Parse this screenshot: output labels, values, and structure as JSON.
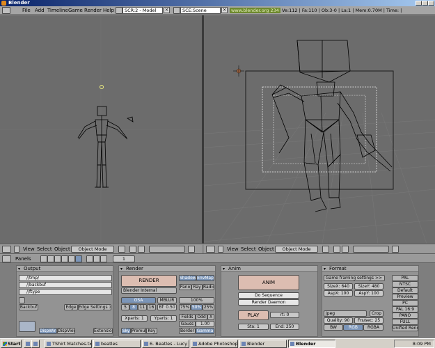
{
  "window": {
    "title": "Blender"
  },
  "info_header": {
    "menus": [
      "File",
      "Add",
      "Timeline",
      "Game",
      "Render",
      "Help"
    ],
    "screen_field": "SCR:2 - Model",
    "scene_field": "SCE:Scene",
    "version": "www.blender.org 234",
    "stats": "Ve:112 | Fa:110 | Ob:3-0 | La:1 | Mem:0.70M | Time: |"
  },
  "left_view_header": {
    "menus": [
      "View",
      "Select",
      "Object"
    ],
    "mode": "Object Mode"
  },
  "right_view_header": {
    "menus": [
      "View",
      "Select",
      "Object"
    ],
    "mode": "Object Mode"
  },
  "buttons_header": {
    "panels_label": "Panels",
    "frame": "1"
  },
  "output_panel": {
    "title": "Output",
    "paths": [
      "//tmp/",
      "//backbuf",
      "//ftype"
    ],
    "backbuf": "Backbuf",
    "edge": "Edge",
    "edge_settings": "Edge Settings >>",
    "dispwin": "DispWin",
    "dispview": "DispView",
    "extensions": "Extensions"
  },
  "render_panel": {
    "title": "Render",
    "render_button": "RENDER",
    "renderer": "Blender Internal",
    "shadow": "Shadow",
    "envmap": "EnvMap",
    "pano": "Pano",
    "ray": "Ray",
    "radio": "Radio",
    "osa": "OSA",
    "mblur": "MBLUR",
    "osa_levels": [
      "5",
      "8",
      "11",
      "16"
    ],
    "bf": "Bf: 0.50",
    "percent_100": "100%",
    "percents": [
      "75%",
      "50%",
      "25%"
    ],
    "xparts": "Xparts: 1",
    "yparts": "Yparts: 1",
    "fields": "Fields",
    "odd": "Odd",
    "x": "X",
    "gauss": "Gauss",
    "gauss_val": "1.00",
    "sky": "Sky",
    "premul": "Premul",
    "key": "Key",
    "border": "Border",
    "gamma": "Gamma"
  },
  "anim_panel": {
    "title": "Anim",
    "anim_button": "ANIM",
    "do_sequence": "Do Sequence",
    "render_daemon": "Render Daemon",
    "play_button": "PLAY",
    "rt": "rt: 0",
    "sta": "Sta: 1",
    "end": "End: 250"
  },
  "format_panel": {
    "title": "Format",
    "game_framing": "Game framing settings",
    "game_framing_arrow": ">>",
    "sizex": "SizeX: 640",
    "sizey": "SizeY: 480",
    "aspx": "AspX: 100",
    "aspy": "AspY: 100",
    "format": "Jpeg",
    "crop": "Crop",
    "quality": "Quality: 90",
    "fps": "Frs/sec: 25",
    "bw": "BW",
    "rgb": "RGB",
    "rgba": "RGBA",
    "presets": [
      "PAL",
      "NTSC",
      "Default",
      "Preview",
      "PC",
      "PAL 16:9",
      "PANO",
      "FULL",
      "Unified Renderer"
    ]
  },
  "taskbar": {
    "start": "Start",
    "tasks": [
      "TShirt Matches.txt - ...",
      "beatles",
      "6. Beatles - Lucy in th...",
      "Adobe Photoshop",
      "Blender",
      "Blender"
    ],
    "clock": "8:09 PM"
  },
  "colors": {
    "viewport_bg": "#6c6c6c",
    "grid_line": "#7c7c7c",
    "wire": "#000000",
    "active_button": "#7b95b8",
    "render_button": "#dcbdb1",
    "camera_border": "#1c1c1c",
    "safe_area": "#f0f0f0"
  }
}
